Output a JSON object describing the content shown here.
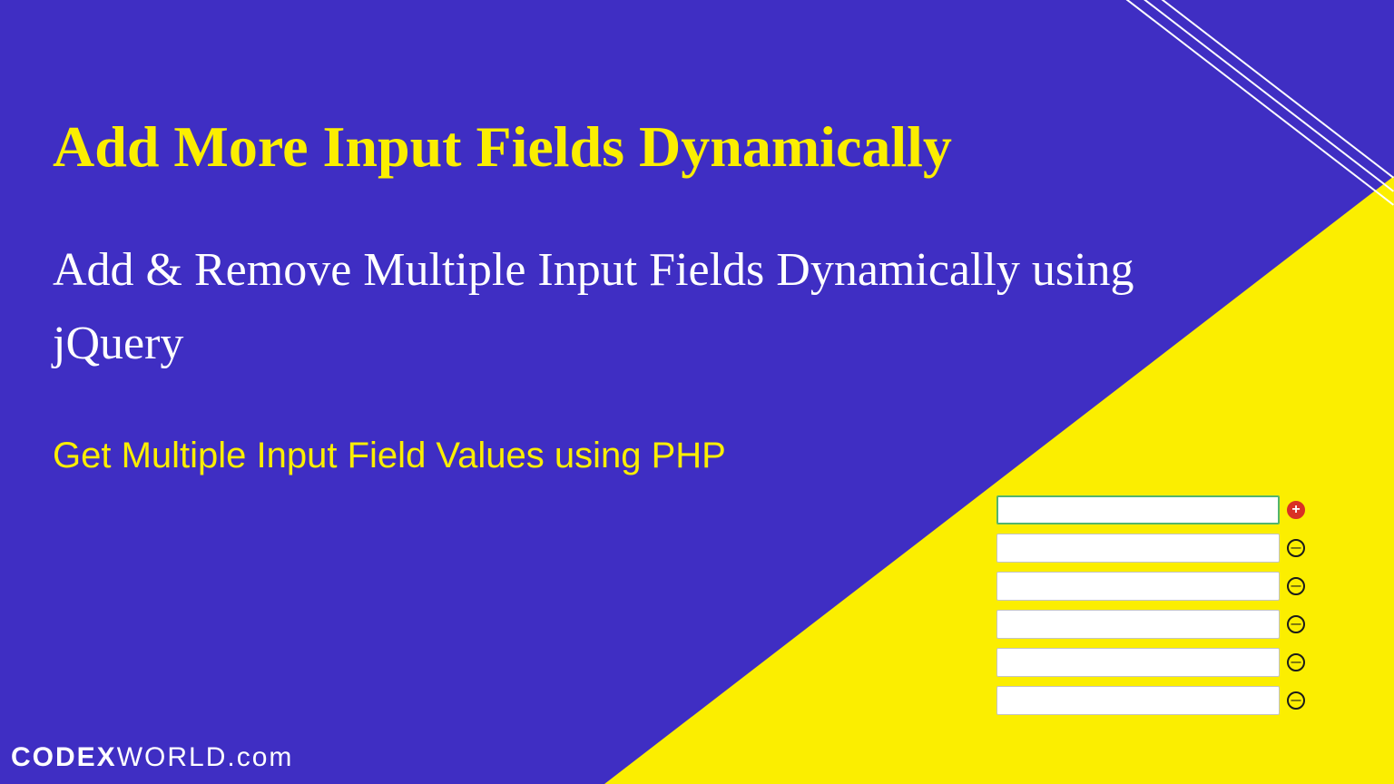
{
  "title": "Add More Input Fields Dynamically",
  "subtitle": "Add & Remove Multiple Input Fields Dynamically using jQuery",
  "tagline": "Get Multiple Input Field Values using PHP",
  "watermark": {
    "brand": "CODEX",
    "brand2": "WORLD",
    "domain": ".com"
  },
  "form": {
    "rows": [
      {
        "type": "add"
      },
      {
        "type": "remove"
      },
      {
        "type": "remove"
      },
      {
        "type": "remove"
      },
      {
        "type": "remove"
      },
      {
        "type": "remove"
      }
    ]
  },
  "colors": {
    "background": "#3F2EC3",
    "accent": "#FBEE00",
    "add_button": "#d93025"
  }
}
